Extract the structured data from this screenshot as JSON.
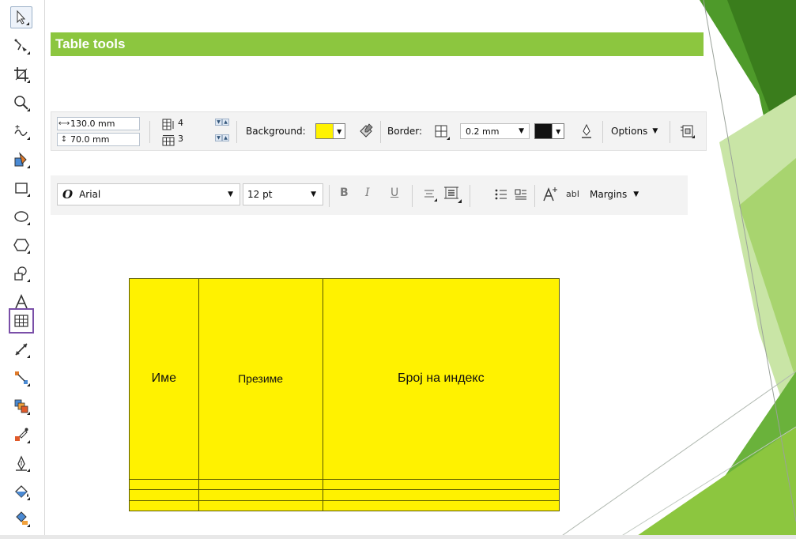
{
  "slide": {
    "title": "Table tools",
    "accent_color": "#8cc63f"
  },
  "table_prop_bar": {
    "width": "130.0 mm",
    "height": "70.0 mm",
    "rows": "4",
    "columns": "3",
    "background_label": "Background:",
    "background_color": "#fff200",
    "border_label": "Border:",
    "border_width": "0.2 mm",
    "border_color": "#111111",
    "options_label": "Options"
  },
  "text_prop_bar": {
    "font_name": "Arial",
    "font_size": "12 pt",
    "bold": "B",
    "italic": "I",
    "underline": "U",
    "char_label": "abI",
    "margins_label": "Margins"
  },
  "table": {
    "headers": [
      "Име",
      "Презиме",
      "Број на индекс"
    ],
    "rows": [
      [
        "",
        "",
        ""
      ],
      [
        "",
        "",
        ""
      ],
      [
        "",
        "",
        ""
      ]
    ]
  },
  "toolbox": {
    "tools": [
      "pick-tool",
      "shape-tool",
      "crop-tool",
      "zoom-tool",
      "freehand-tool",
      "smart-fill-tool",
      "rectangle-tool",
      "ellipse-tool",
      "polygon-tool",
      "basic-shapes-tool",
      "text-tool",
      "table-tool",
      "dimension-tool",
      "connector-tool",
      "blend-tool",
      "eyedropper-tool",
      "outline-pen-tool",
      "fill-tool",
      "interactive-fill-tool"
    ],
    "active_tool": "table-tool"
  }
}
